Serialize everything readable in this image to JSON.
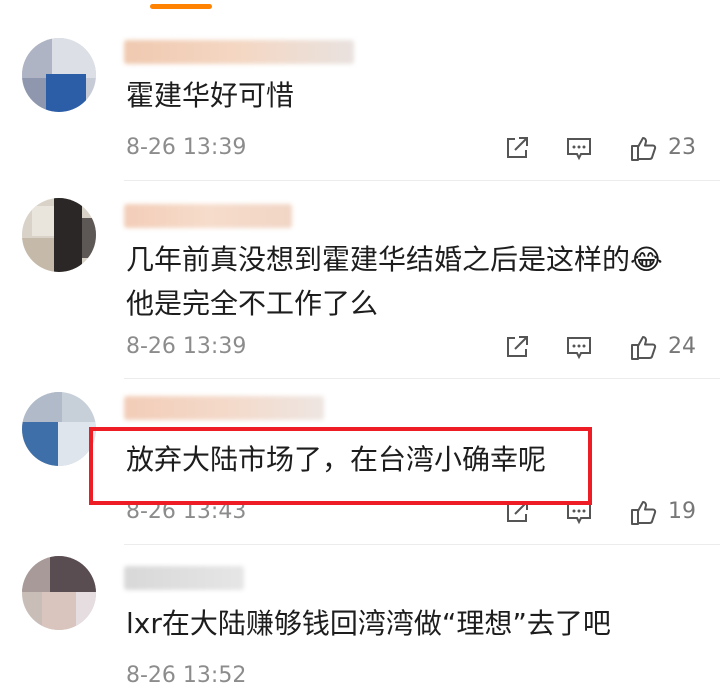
{
  "colors": {
    "accent": "#ff8200",
    "highlight": "#ee1c24",
    "meta": "#8c8c8c"
  },
  "comments": [
    {
      "content_lines": [
        "霍建华好可惜"
      ],
      "time": "8-26 13:39",
      "likes": "23"
    },
    {
      "content_lines": [
        "几年前真没想到霍建华结婚之后是这样的",
        "他是完全不工作了么"
      ],
      "emoji": "😂",
      "time": "8-26 13:39",
      "likes": "24"
    },
    {
      "content_lines": [
        "放弃大陆市场了，在台湾小确幸呢"
      ],
      "time": "8-26 13:43",
      "likes": "19"
    },
    {
      "content_lines": [
        "lxr在大陆赚够钱回湾湾做“理想”去了吧"
      ],
      "time": "8-26 13:52",
      "likes": ""
    }
  ],
  "icons": {
    "share": "share-icon",
    "reply": "comment-icon",
    "like": "thumbs-up-icon"
  }
}
